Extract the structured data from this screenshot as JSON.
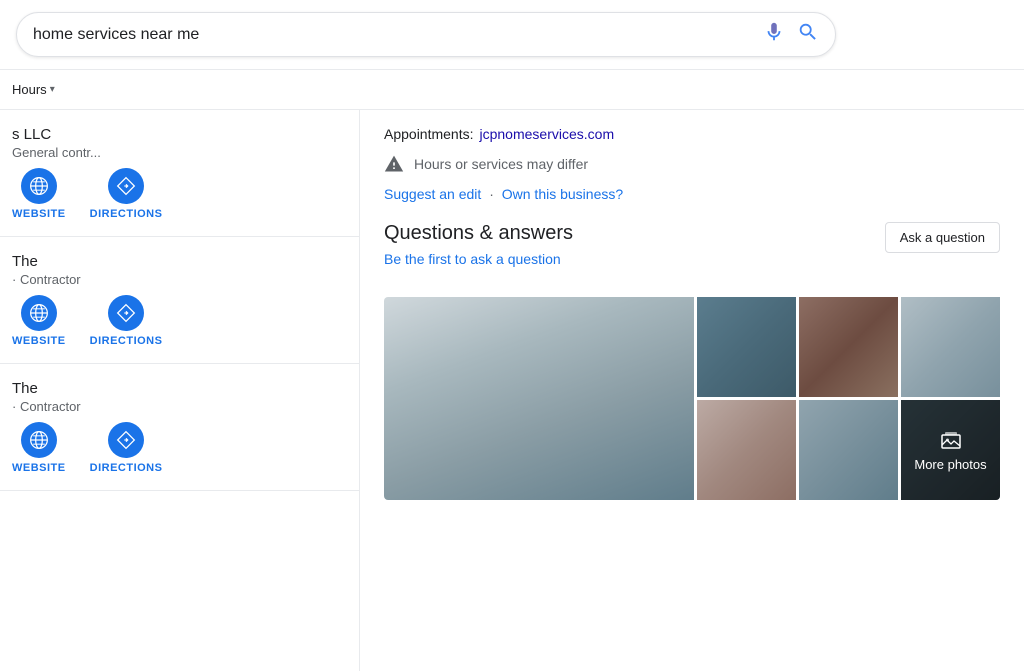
{
  "search": {
    "query": "home services near me",
    "mic_label": "mic",
    "search_label": "search"
  },
  "filters": {
    "hours_label": "Hours",
    "hours_caret": "▾"
  },
  "businesses": [
    {
      "id": "b1",
      "name": "s LLC",
      "type": "General contr...",
      "website_label": "WEBSITE",
      "directions_label": "DIRECTIONS"
    },
    {
      "id": "b2",
      "name": "The",
      "type": "· Contractor",
      "website_label": "WEBSITE",
      "directions_label": "DIRECTIONS"
    },
    {
      "id": "b3",
      "name": "The",
      "type": "· Contractor",
      "website_label": "WEBSITE",
      "directions_label": "DIRECTIONS"
    }
  ],
  "knowledge_panel": {
    "appointments_label": "Appointments:",
    "appointments_url": "jcpnomeservices.com",
    "hours_warning": "Hours or services may differ",
    "suggest_edit": "Suggest an edit",
    "own_business": "Own this business?",
    "qa_title": "Questions & answers",
    "qa_first": "Be the first to ask a question",
    "ask_question_label": "Ask a question",
    "more_photos_label": "More photos"
  },
  "photos": [
    {
      "id": "main",
      "color": "#b8c4c8",
      "alt": "staircase"
    },
    {
      "id": "tile",
      "color": "#6b8fa0",
      "alt": "tile work"
    },
    {
      "id": "kitchen",
      "color": "#7a6355",
      "alt": "kitchen"
    },
    {
      "id": "floor",
      "color": "#9e8877",
      "alt": "floor"
    },
    {
      "id": "room",
      "color": "#8ca0ab",
      "alt": "room"
    }
  ],
  "colors": {
    "google_blue": "#1a73e8",
    "google_red": "#ea4335",
    "google_green": "#34a853",
    "google_yellow": "#fbbc04"
  }
}
